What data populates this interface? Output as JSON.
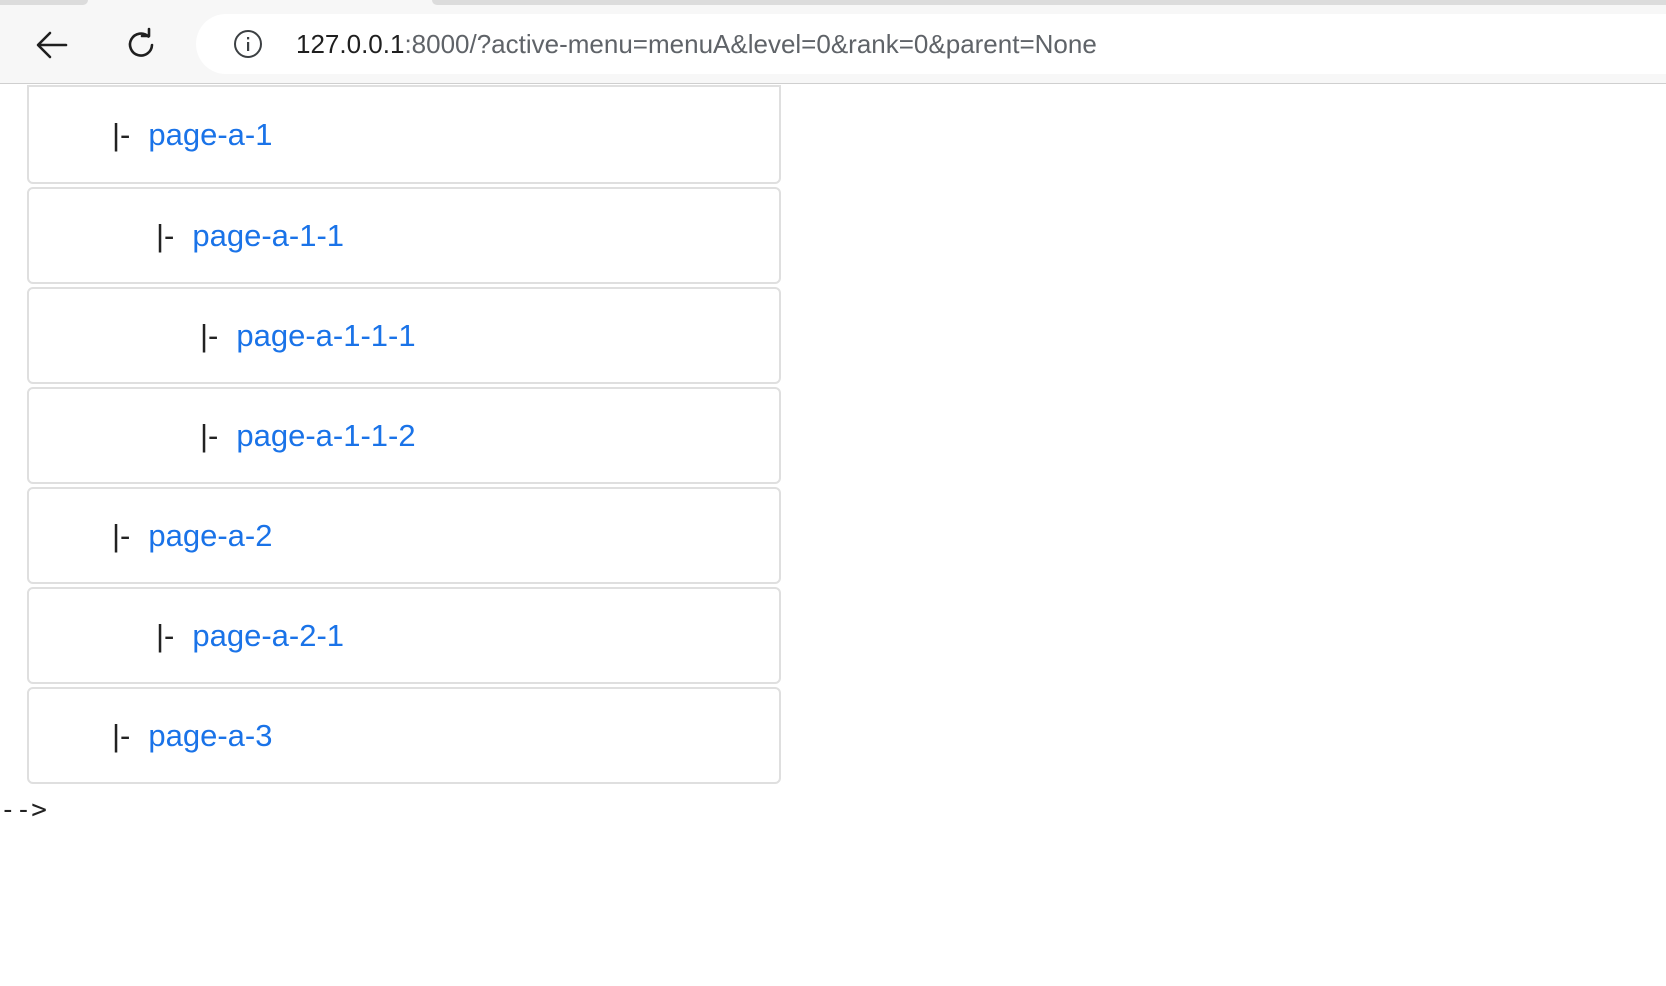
{
  "browser": {
    "url_host": "127.0.0.1",
    "url_rest": ":8000/?active-menu=menuA&level=0&rank=0&parent=None",
    "icons": {
      "back": "arrow-left-icon",
      "reload": "reload-icon",
      "info": "info-circle-icon"
    }
  },
  "tree": {
    "branch_marker": "|-",
    "items": [
      {
        "label": "page-a-1",
        "level": 1
      },
      {
        "label": "page-a-1-1",
        "level": 2
      },
      {
        "label": "page-a-1-1-1",
        "level": 3
      },
      {
        "label": "page-a-1-1-2",
        "level": 3
      },
      {
        "label": "page-a-2",
        "level": 1
      },
      {
        "label": "page-a-2-1",
        "level": 2
      },
      {
        "label": "page-a-3",
        "level": 1
      }
    ]
  },
  "trailing_text": "-->",
  "colors": {
    "link": "#1a73e8",
    "text": "#222222",
    "border": "#dfdfdf"
  }
}
